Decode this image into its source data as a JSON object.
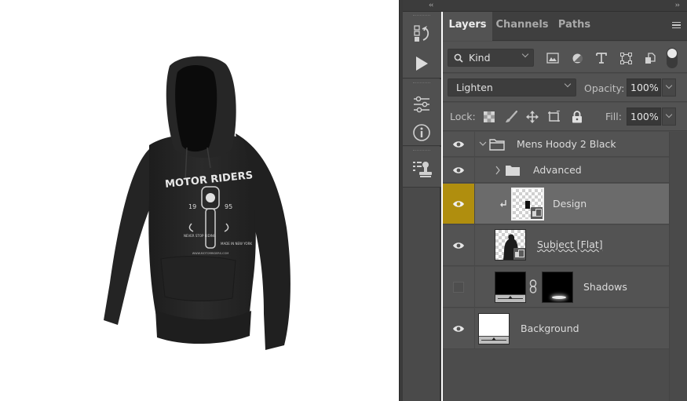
{
  "canvas": {
    "artwork": {
      "title": "MOTOR RIDERS",
      "year_left": "19",
      "year_right": "95",
      "tagline_left": "NEVER STOP RIDING",
      "tagline_right": "MADE IN NEW YORK",
      "footer": "WWW.MOTORRIDERS.COM"
    }
  },
  "panel": {
    "collapse_left": "‹‹",
    "collapse_right": "››",
    "tabs": [
      {
        "label": "Layers",
        "active": true
      },
      {
        "label": "Channels",
        "active": false
      },
      {
        "label": "Paths",
        "active": false
      }
    ],
    "filter": {
      "kind_label": "Kind",
      "icons": [
        "image-filter-icon",
        "adjustment-filter-icon",
        "type-filter-icon",
        "shape-filter-icon",
        "smart-object-filter-icon"
      ]
    },
    "blend_mode": "Lighten",
    "opacity_label": "Opacity:",
    "opacity_value": "100%",
    "lock_label": "Lock:",
    "fill_label": "Fill:",
    "fill_value": "100%"
  },
  "tools": [
    {
      "name": "history-icon"
    },
    {
      "name": "actions-play-icon"
    },
    {
      "name": "adjustments-icon"
    },
    {
      "name": "info-icon"
    },
    {
      "name": "clone-source-icon"
    }
  ],
  "layers": [
    {
      "name": "Mens Hoody 2 Black",
      "type": "group",
      "expanded": true,
      "visible": true,
      "selected": false
    },
    {
      "name": "Advanced",
      "type": "group",
      "expanded": false,
      "visible": true,
      "selected": false
    },
    {
      "name": "Design",
      "type": "smart-object",
      "clipped": true,
      "visible": true,
      "selected": true
    },
    {
      "name": "Subject [Flat]",
      "type": "smart-object",
      "visible": true,
      "selected": false
    },
    {
      "name": "Shadows",
      "type": "fill-with-mask",
      "visible": false,
      "selected": false
    },
    {
      "name": "Background",
      "type": "background",
      "visible": true,
      "selected": false
    }
  ],
  "colors": {
    "selected_eye_bg": "#b08e0e",
    "panel_bg": "#535353"
  }
}
